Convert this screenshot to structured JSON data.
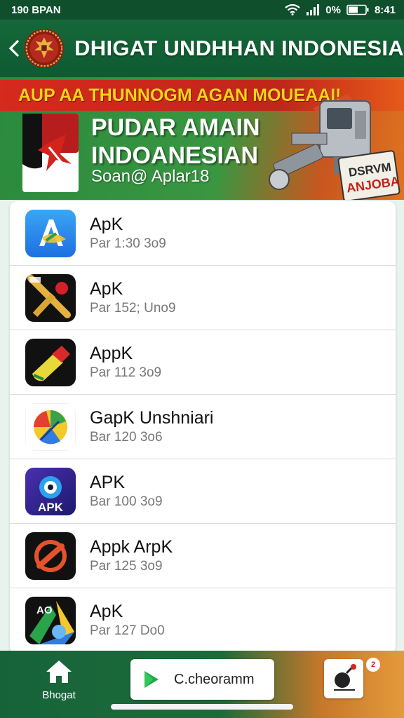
{
  "status": {
    "time": "190 BPAN",
    "battery": "0%",
    "clock": "8:41"
  },
  "header": {
    "title": "DHIGAT UNDHHAN INDONESIA"
  },
  "banner": {
    "ribbon": "AUP AA THUNNOGM AGAN MOUEAAI!",
    "title_line1": "PUDAR AMAIN",
    "title_line2": "INDOANESIAN",
    "subtitle": "Soan@ Aplar18",
    "sign_line1": "DSRVM",
    "sign_line2": "ANJOBA"
  },
  "items": [
    {
      "title": "ApK",
      "sub": "Par 1:30 3o9",
      "icon": "app-store-icon"
    },
    {
      "title": "ApK",
      "sub": "Par 152; Uno9",
      "icon": "cricket-bat-icon"
    },
    {
      "title": "AppK",
      "sub": "Par 112 3o9",
      "icon": "whistle-icon"
    },
    {
      "title": "GapK Unshniari",
      "sub": "Bar 120 3o6",
      "icon": "colorful-chart-icon"
    },
    {
      "title": "APK",
      "sub": "Bar 100 3o9",
      "icon": "apk-eye-icon",
      "icon_text": "APK"
    },
    {
      "title": "Appk ArpK",
      "sub": "Par 125 3o9",
      "icon": "no-symbol-icon"
    },
    {
      "title": "ApK",
      "sub": "Par 127 Do0",
      "icon": "ao-drive-icon",
      "icon_text": "AO"
    }
  ],
  "bottom": {
    "home_label": "Bhogat",
    "play_label": "C.cheoramm",
    "badge": "2"
  }
}
